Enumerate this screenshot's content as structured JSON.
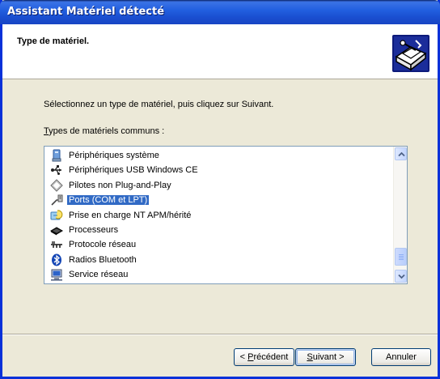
{
  "window": {
    "title": "Assistant Matériel détecté"
  },
  "header": {
    "title": "Type de matériel.",
    "icon": "hardware-wizard-icon"
  },
  "content": {
    "instruction": "Sélectionnez un type de matériel, puis cliquez sur Suivant.",
    "list_label_accel": "T",
    "list_label_rest": "ypes de matériels communs :"
  },
  "list": {
    "items": [
      {
        "label": "Périphériques système",
        "icon": "system-devices-icon"
      },
      {
        "label": "Périphériques USB Windows CE",
        "icon": "usb-icon"
      },
      {
        "label": "Pilotes non Plug-and-Play",
        "icon": "non-pnp-driver-icon"
      },
      {
        "label": "Ports (COM et LPT)",
        "icon": "port-connector-icon",
        "selected": true
      },
      {
        "label": "Prise en charge NT APM/hérité",
        "icon": "apm-support-icon"
      },
      {
        "label": "Processeurs",
        "icon": "processor-icon"
      },
      {
        "label": "Protocole réseau",
        "icon": "network-protocol-icon"
      },
      {
        "label": "Radios Bluetooth",
        "icon": "bluetooth-icon"
      },
      {
        "label": "Service réseau",
        "icon": "network-service-icon"
      },
      {
        "label": "",
        "icon": "partial-item-icon"
      }
    ]
  },
  "buttons": {
    "prev_prefix": "< ",
    "prev_accel": "P",
    "prev_rest": "récédent",
    "next_accel": "S",
    "next_rest": "uivant >",
    "cancel": "Annuler"
  },
  "colors": {
    "titlebar": "#0a5fe4",
    "selection": "#316ac5",
    "dialog_bg": "#ece9d8"
  }
}
